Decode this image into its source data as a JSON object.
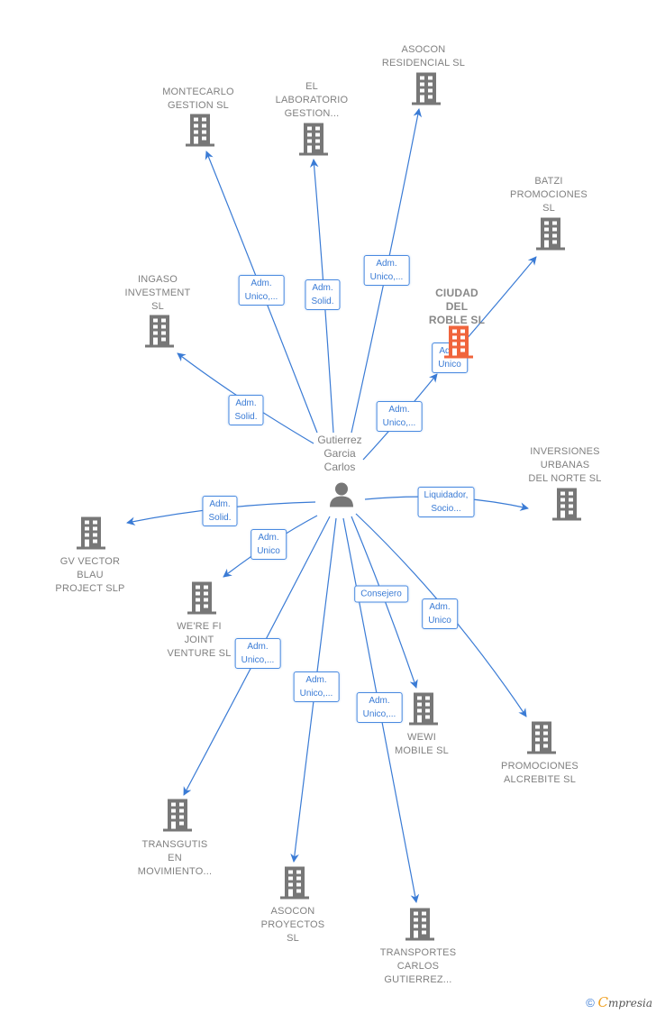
{
  "center": {
    "name": "Gutierrez\nGarcia\nCarlos",
    "icon": "person-icon"
  },
  "colors": {
    "edge": "#3a7bd5",
    "building": "#777777",
    "focus_building": "#f0643c",
    "label_text": "#808080"
  },
  "companies": [
    {
      "id": "montecarlo",
      "name": "MONTECARLO\nGESTION SL",
      "role": "Adm.\nUnico,...",
      "icon": "building-icon"
    },
    {
      "id": "laboratorio",
      "name": "EL\nLABORATORIO\nGESTION...",
      "role": "Adm.\nSolid.",
      "icon": "building-icon"
    },
    {
      "id": "asocon-residencial",
      "name": "ASOCON\nRESIDENCIAL SL",
      "role": "Adm.\nUnico,...",
      "icon": "building-icon"
    },
    {
      "id": "batzi",
      "name": "BATZI\nPROMOCIONES\nSL",
      "role": "Adm.\nUnico",
      "icon": "building-icon"
    },
    {
      "id": "ciudad-roble",
      "name": "CIUDAD\nDEL\nROBLE  SL",
      "role": "Adm.\nUnico,...",
      "icon": "building-icon",
      "focus": true
    },
    {
      "id": "ingaso",
      "name": "INGASO\nINVESTMENT\nSL",
      "role": "Adm.\nSolid.",
      "icon": "building-icon"
    },
    {
      "id": "inversiones-urbanas",
      "name": "INVERSIONES\nURBANAS\nDEL NORTE SL",
      "role": "Liquidador,\nSocio...",
      "icon": "building-icon"
    },
    {
      "id": "gv-vector",
      "name": "GV VECTOR\nBLAU\nPROJECT  SLP",
      "role": "Adm.\nSolid.",
      "icon": "building-icon"
    },
    {
      "id": "were-fi",
      "name": "WE'RE FI\nJOINT\nVENTURE  SL",
      "role": "Adm.\nUnico",
      "icon": "building-icon"
    },
    {
      "id": "wewi",
      "name": "WEWI\nMOBILE  SL",
      "role": "Consejero",
      "icon": "building-icon"
    },
    {
      "id": "alcrebite",
      "name": "PROMOCIONES\nALCREBITE  SL",
      "role": "Adm.\nUnico",
      "icon": "building-icon"
    },
    {
      "id": "transgutis",
      "name": "TRANSGUTIS\nEN\nMOVIMIENTO...",
      "role": "Adm.\nUnico,...",
      "icon": "building-icon"
    },
    {
      "id": "asocon-proyectos",
      "name": "ASOCON\nPROYECTOS\nSL",
      "role": "Adm.\nUnico,...",
      "icon": "building-icon"
    },
    {
      "id": "transportes-carlos",
      "name": "TRANSPORTES\nCARLOS\nGUTIERREZ...",
      "role": "Adm.\nUnico,...",
      "icon": "building-icon"
    }
  ],
  "footer": {
    "copyright": "©",
    "brand_initial": "C",
    "brand_rest": "mpresia"
  }
}
